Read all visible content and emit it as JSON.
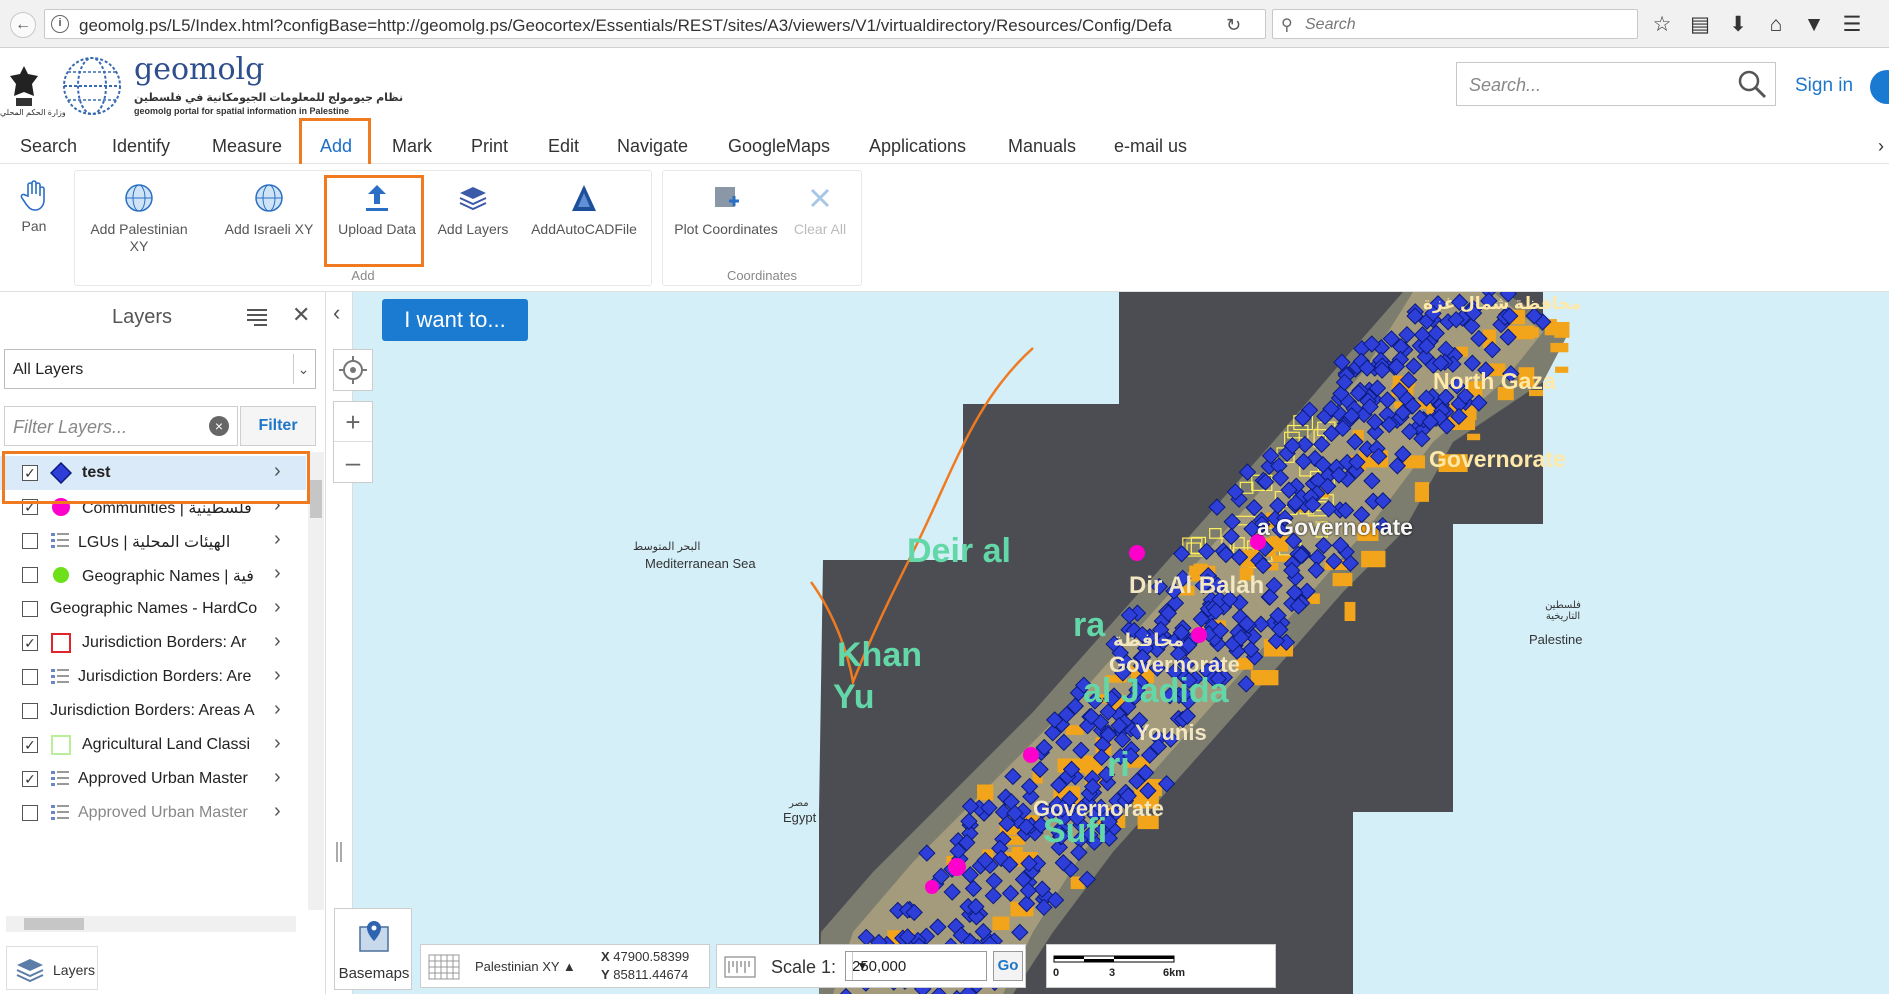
{
  "browser": {
    "url": "geomolg.ps/L5/Index.html?configBase=http://geomolg.ps/Geocortex/Essentials/REST/sites/A3/viewers/V1/virtualdirectory/Resources/Config/Defa",
    "search_placeholder": "Search"
  },
  "header": {
    "brand_name": "geomolg",
    "brand_ar": "نظام جيومولج للمعلومات الجيومكانية في فلسطين",
    "brand_en": "geomolg portal for spatial information in Palestine",
    "ministry": "وزارة الحكم المحلي",
    "search_placeholder": "Search...",
    "signin": "Sign in"
  },
  "menu": {
    "items": [
      "Search",
      "Identify",
      "Measure",
      "Add",
      "Mark",
      "Print",
      "Edit",
      "Navigate",
      "GoogleMaps",
      "Applications",
      "Manuals",
      "e-mail us"
    ],
    "active": "Add"
  },
  "toolbar": {
    "pan": "Pan",
    "add_group": {
      "label": "Add",
      "buttons": [
        "Add Palestinian XY",
        "Add Israeli XY",
        "Upload Data",
        "Add Layers",
        "AddAutoCADFile"
      ]
    },
    "coords_group": {
      "label": "Coordinates",
      "buttons": [
        "Plot Coordinates",
        "Clear All"
      ]
    }
  },
  "layers_panel": {
    "title": "Layers",
    "select_value": "All Layers",
    "filter_placeholder": "Filter Layers...",
    "filter_button": "Filter",
    "bottom_tab": "Layers",
    "layers": [
      {
        "name": "test",
        "checked": true,
        "symbol": "blue-diamond",
        "selected": true
      },
      {
        "name": "Communities | فلسطينية",
        "checked": true,
        "symbol": "magenta-dot"
      },
      {
        "name": "LGUs | الهيئات المحلية",
        "checked": false,
        "symbol": "legend-list"
      },
      {
        "name": "Geographic Names | فية",
        "checked": false,
        "symbol": "green-dot"
      },
      {
        "name": "Geographic Names - HardCo",
        "checked": false,
        "symbol": "none"
      },
      {
        "name": "Jurisdiction Borders: Ar",
        "checked": true,
        "symbol": "red-square"
      },
      {
        "name": "Jurisdiction Borders: Are",
        "checked": false,
        "symbol": "legend-list"
      },
      {
        "name": "Jurisdiction Borders: Areas A",
        "checked": false,
        "symbol": "none"
      },
      {
        "name": "Agricultural Land Classi",
        "checked": true,
        "symbol": "green-square"
      },
      {
        "name": "Approved Urban Master",
        "checked": true,
        "symbol": "legend-list"
      },
      {
        "name": "Approved Urban Master",
        "checked": false,
        "symbol": "legend-list",
        "dim": true
      }
    ]
  },
  "map": {
    "i_want_to": "I want to...",
    "labels": {
      "sea_ar": "البحر المتوسط",
      "sea_en": "Mediterranean Sea",
      "north_gaza_ar": "محافظة شمال غزة",
      "north_gaza": "North Gaza",
      "governorate": "Governorate",
      "gaza_gov": "a Governorate",
      "deir": "Deir al",
      "dir_al_balah": "Dir Al Balah",
      "khan": "Khan",
      "yu": "Yu",
      "ra": "ra",
      "mohafaza": "محافظة",
      "jadida": "al Jadida",
      "governorate2": "Governorate",
      "younis": "Younis",
      "ri": "ri",
      "governorate3": "Governorate",
      "sufi": "Sufi",
      "palestine_ar": "فلسطين التاريخية",
      "palestine": "Palestine",
      "egypt": "Egypt",
      "egypt_ar": "مصر"
    },
    "basemaps": "Basemaps",
    "coordinates": {
      "projection": "Palestinian XY ▲",
      "x": "47900.58399",
      "y": "85811.44674"
    },
    "scale": {
      "label": "Scale 1:",
      "value": "250,000",
      "go": "Go"
    },
    "scalebar": {
      "ticks": [
        "0",
        "3",
        "6km"
      ]
    }
  },
  "colors": {
    "accent": "#1a7bd1",
    "highlight": "#f07a1f",
    "diamond": "#2d3fd8",
    "urban_yellow": "#ffef5c",
    "urban_orange": "#f2a51a"
  }
}
